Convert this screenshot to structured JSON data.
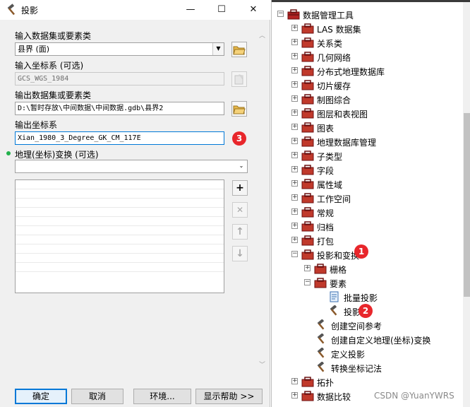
{
  "dialog": {
    "title": "投影",
    "controls": {
      "minimize": "—",
      "maximize": "☐",
      "close": "✕"
    },
    "input_dataset": {
      "label": "输入数据集或要素类",
      "value": "县界 (面)"
    },
    "input_crs": {
      "label": "输入坐标系 (可选)",
      "value": "GCS_WGS_1984"
    },
    "output_dataset": {
      "label": "输出数据集或要素类",
      "value": "D:\\暂时存放\\中间数据\\中间数据.gdb\\县界2"
    },
    "output_crs": {
      "label": "输出坐标系",
      "value": "Xian_1980_3_Degree_GK_CM_117E"
    },
    "transform": {
      "label": "地理(坐标)变换 (可选)",
      "value": ""
    },
    "list_buttons": {
      "add": "+",
      "remove": "✕",
      "up": "↑",
      "down": "↓"
    },
    "buttons": {
      "ok": "确定",
      "cancel": "取消",
      "env": "环境...",
      "help": "显示帮助 >>"
    },
    "badge": "3"
  },
  "tree": {
    "root": "数据管理工具",
    "items": [
      {
        "label": "LAS 数据集"
      },
      {
        "label": "关系类"
      },
      {
        "label": "几何网络"
      },
      {
        "label": "分布式地理数据库"
      },
      {
        "label": "切片缓存"
      },
      {
        "label": "制图综合"
      },
      {
        "label": "图层和表视图"
      },
      {
        "label": "图表"
      },
      {
        "label": "地理数据库管理"
      },
      {
        "label": "子类型"
      },
      {
        "label": "字段"
      },
      {
        "label": "属性域"
      },
      {
        "label": "工作空间"
      },
      {
        "label": "常规"
      },
      {
        "label": "归档"
      },
      {
        "label": "打包"
      },
      {
        "label": "投影和变换"
      }
    ],
    "proj_children": {
      "raster": "栅格",
      "feature": "要素",
      "feature_children": [
        "批量投影",
        "投影"
      ],
      "tools": [
        "创建空间参考",
        "创建自定义地理(坐标)变换",
        "定义投影",
        "转换坐标记法"
      ]
    },
    "after": [
      "拓扑",
      "数据比较"
    ],
    "badges": {
      "one": "1",
      "two": "2"
    },
    "watermark": "CSDN @YuanYWRS"
  }
}
